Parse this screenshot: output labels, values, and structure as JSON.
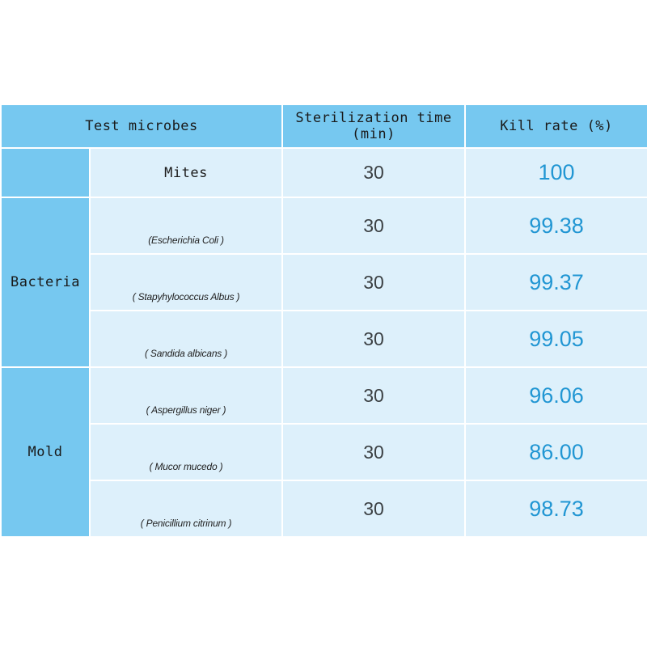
{
  "table": {
    "headers": {
      "test_microbes": "Test microbes",
      "sterilization_time": "Sterilization time (min)",
      "kill_rate": "Kill rate (%)"
    },
    "groups": {
      "blank": "",
      "bacteria": "Bacteria",
      "mold": "Mold"
    },
    "rows": [
      {
        "group": "",
        "name": "Mites",
        "time": "30",
        "rate": "100"
      },
      {
        "group": "Bacteria",
        "name": "(Escherichia Coli )",
        "time": "30",
        "rate": "99.38"
      },
      {
        "group": "Bacteria",
        "name": "( Stapyhylococcus Albus )",
        "time": "30",
        "rate": "99.37"
      },
      {
        "group": "Bacteria",
        "name": "( Sandida albicans )",
        "time": "30",
        "rate": "99.05"
      },
      {
        "group": "Mold",
        "name": "( Aspergillus niger )",
        "time": "30",
        "rate": "96.06"
      },
      {
        "group": "Mold",
        "name": "( Mucor mucedo )",
        "time": "30",
        "rate": "86.00"
      },
      {
        "group": "Mold",
        "name": "( Penicillium citrinum )",
        "time": "30",
        "rate": "98.73"
      }
    ]
  },
  "colors": {
    "header_blue": "#76c8f0",
    "cell_blue": "#ddf0fb",
    "rate_text": "#2196d3",
    "time_text": "#3b4043",
    "page_background": "#ffffff"
  }
}
